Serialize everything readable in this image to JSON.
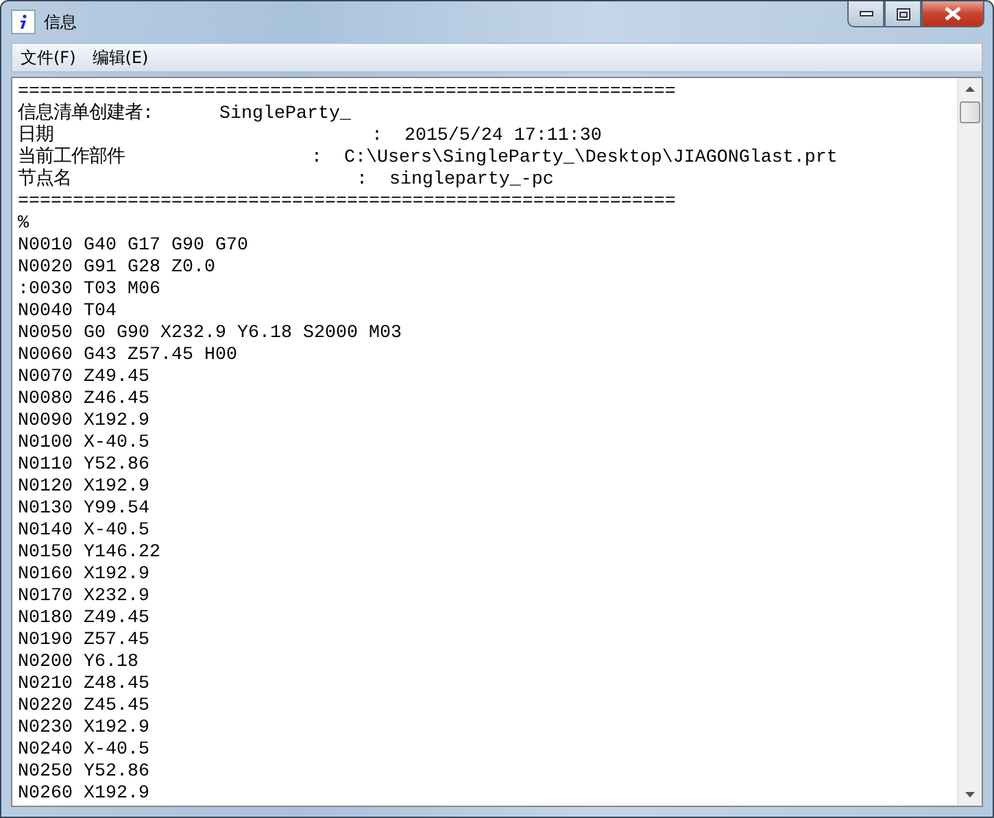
{
  "window": {
    "title": "信息"
  },
  "menu": [
    {
      "label": "文件(F)"
    },
    {
      "label": "编辑(E)"
    }
  ],
  "lines": [
    "============================================================",
    "信息清单创建者:      SingleParty_",
    "日期                             :  2015/5/24 17:11:30",
    "当前工作部件                 :  C:\\Users\\SingleParty_\\Desktop\\JIAGONGlast.prt",
    "节点名                          :  singleparty_-pc",
    "============================================================",
    "%",
    "N0010 G40 G17 G90 G70",
    "N0020 G91 G28 Z0.0",
    ":0030 T03 M06",
    "N0040 T04",
    "N0050 G0 G90 X232.9 Y6.18 S2000 M03",
    "N0060 G43 Z57.45 H00",
    "N0070 Z49.45",
    "N0080 Z46.45",
    "N0090 X192.9",
    "N0100 X-40.5",
    "N0110 Y52.86",
    "N0120 X192.9",
    "N0130 Y99.54",
    "N0140 X-40.5",
    "N0150 Y146.22",
    "N0160 X192.9",
    "N0170 X232.9",
    "N0180 Z49.45",
    "N0190 Z57.45",
    "N0200 Y6.18",
    "N0210 Z48.45",
    "N0220 Z45.45",
    "N0230 X192.9",
    "N0240 X-40.5",
    "N0250 Y52.86",
    "N0260 X192.9"
  ]
}
